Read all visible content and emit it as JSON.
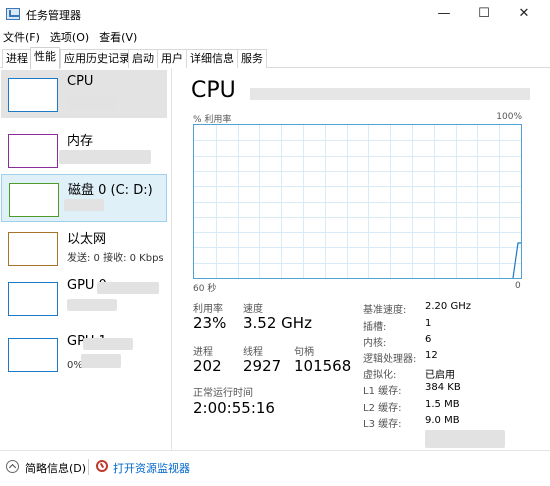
{
  "window": {
    "title": "任务管理器"
  },
  "menu": [
    "文件(F)",
    "选项(O)",
    "查看(V)"
  ],
  "tabs": [
    "进程",
    "性能",
    "应用历史记录",
    "启动",
    "用户",
    "详细信息",
    "服务"
  ],
  "active_tab": "性能",
  "sidebar": {
    "items": [
      {
        "name": "CPU",
        "sub": "",
        "color": "#1e78c8"
      },
      {
        "name": "内存",
        "sub": "",
        "color": "#8b2c9a"
      },
      {
        "name": "磁盘 0 (C: D:)",
        "sub": "",
        "color": "#4f9b2a"
      },
      {
        "name": "以太网",
        "sub": "发送: 0 接收: 0 Kbps",
        "color": "#a8732a"
      },
      {
        "name": "GPU 0",
        "sub": "",
        "color": "#1e78c8"
      },
      {
        "name": "GPU 1",
        "sub": "0%",
        "color": "#1e78c8"
      }
    ]
  },
  "main": {
    "title": "CPU",
    "graph": {
      "label_top_left": "% 利用率",
      "label_top_right": "100%",
      "label_bottom_left": "60 秒",
      "label_bottom_right": "0",
      "line_color": "#1e78c8",
      "grid_color": "#d8ebf6"
    },
    "stats": {
      "utilization_label": "利用率",
      "utilization_value": "23%",
      "speed_label": "速度",
      "speed_value": "3.52 GHz",
      "processes_label": "进程",
      "processes_value": "202",
      "threads_label": "线程",
      "threads_value": "2927",
      "handles_label": "句柄",
      "handles_value": "101568",
      "uptime_label": "正常运行时间",
      "uptime_value": "2:00:55:16"
    },
    "specs": [
      {
        "label": "基准速度:",
        "value": "2.20 GHz"
      },
      {
        "label": "插槽:",
        "value": "1"
      },
      {
        "label": "内核:",
        "value": "6"
      },
      {
        "label": "逻辑处理器:",
        "value": "12"
      },
      {
        "label": "虚拟化:",
        "value": "已启用"
      },
      {
        "label": "L1 缓存:",
        "value": "384 KB"
      },
      {
        "label": "L2 缓存:",
        "value": "1.5 MB"
      },
      {
        "label": "L3 缓存:",
        "value": "9.0 MB"
      }
    ]
  },
  "footer": {
    "less_details": "简略信息(D)",
    "open_monitor": "打开资源监视器"
  }
}
